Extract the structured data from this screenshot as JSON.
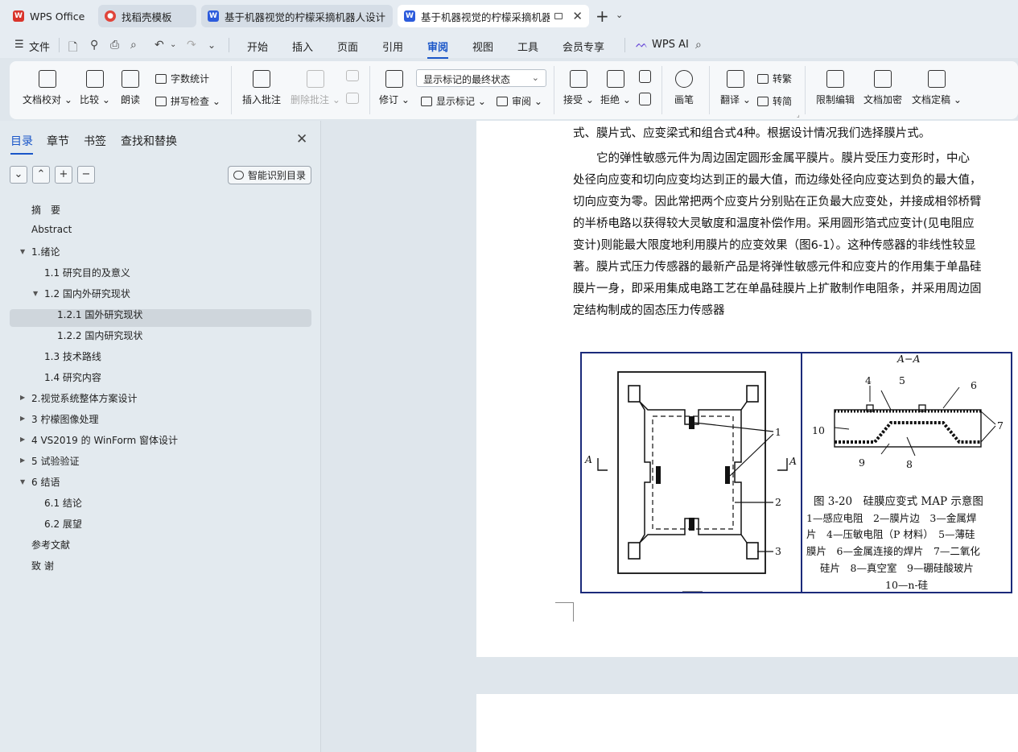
{
  "tabs": [
    {
      "label": "WPS Office",
      "icon": "wps-logo-icon",
      "color": "#d9342b"
    },
    {
      "label": "找稻壳模板",
      "icon": "daoke-icon",
      "color": "#e0443a"
    },
    {
      "label": "基于机器视觉的柠檬采摘机器人设计：",
      "icon": "writer-doc-icon",
      "color": "#2c5bdc"
    },
    {
      "label": "基于机器视觉的柠檬采摘机器人",
      "icon": "writer-doc-icon",
      "color": "#2c5bdc"
    }
  ],
  "menu": {
    "file": "文件",
    "items": [
      "开始",
      "插入",
      "页面",
      "引用",
      "审阅",
      "视图",
      "工具",
      "会员专享"
    ],
    "active": "审阅",
    "wps_ai": "WPS AI"
  },
  "ribbon": {
    "doc_check": "文档校对",
    "compare": "比较",
    "read_aloud": "朗读",
    "word_count": "字数统计",
    "spell_check": "拼写检查",
    "insert_comment": "插入批注",
    "delete_comment": "删除批注",
    "revise": "修订",
    "markup_state": "显示标记的最终状态",
    "show_markup": "显示标记",
    "review": "审阅",
    "accept": "接受",
    "reject": "拒绝",
    "pen": "画笔",
    "translate": "翻译",
    "to_traditional": "转繁",
    "to_simplified": "转简",
    "restrict_edit": "限制编辑",
    "encrypt": "文档加密",
    "finalize": "文档定稿"
  },
  "nav": {
    "tabs": [
      "目录",
      "章节",
      "书签",
      "查找和替换"
    ],
    "smart_btn": "智能识别目录",
    "toc": [
      {
        "text": "摘　要",
        "level": 0
      },
      {
        "text": "Abstract",
        "level": 0
      },
      {
        "text": "1.绪论",
        "level": 0,
        "expanded": true
      },
      {
        "text": "1.1 研究目的及意义",
        "level": 1
      },
      {
        "text": "1.2 国内外研究现状",
        "level": 1,
        "expanded": true
      },
      {
        "text": "1.2.1 国外研究现状",
        "level": 2
      },
      {
        "text": "1.2.2 国内研究现状",
        "level": 2
      },
      {
        "text": "1.3  技术路线",
        "level": 1
      },
      {
        "text": "1.4  研究内容",
        "level": 1
      },
      {
        "text": "2.视觉系统整体方案设计",
        "level": 0,
        "collapsed": true
      },
      {
        "text": "3  柠檬图像处理",
        "level": 0,
        "collapsed": true
      },
      {
        "text": "4 VS2019 的 WinForm 窗体设计",
        "level": 0,
        "collapsed": true,
        "selected": true
      },
      {
        "text": "5  试验验证",
        "level": 0,
        "collapsed": true
      },
      {
        "text": "6  结语",
        "level": 0,
        "expanded": true
      },
      {
        "text": "6.1  结论",
        "level": 1
      },
      {
        "text": "6.2  展望",
        "level": 1
      },
      {
        "text": "参考文献",
        "level": 0
      },
      {
        "text": "致 谢",
        "level": 0
      }
    ]
  },
  "doc": {
    "lines": [
      "式、膜片式、应变梁式和组合式4种。根据设计情况我们选择膜片式。",
      "　　它的弹性敏感元件为周边固定圆形金属平膜片。膜片受压力变形时，中心",
      "处径向应变和切向应变均达到正的最大值，而边缘处径向应变达到负的最大值，",
      "切向应变为零。因此常把两个应变片分别贴在正负最大应变处，并接成相邻桥臂",
      "的半桥电路以获得较大灵敏度和温度补偿作用。采用圆形箔式应变计(见电阻应",
      "变计)则能最大限度地利用膜片的应变效果（图6-1）。这种传感器的非线性较显",
      "著。膜片式压力传感器的最新产品是将弹性敏感元件和应变片的作用集于单晶硅",
      "膜片一身，即采用集成电路工艺在单晶硅膜片上扩散制作电阻条，并采用周边固",
      "定结构制成的固态压力传感器"
    ],
    "figure": {
      "section_label": "A−A",
      "left_labels": [
        "A",
        "A",
        "1",
        "2",
        "3"
      ],
      "right_labels": [
        "4",
        "5",
        "6",
        "7",
        "10",
        "9",
        "8"
      ],
      "caption_title": "图 3-20　硅膜应变式 MAP 示意图",
      "caption_lines": [
        "1—感应电阻　2—膜片边　3—金属焊",
        "片　4—压敏电阻（P 材料）　5—薄硅",
        "膜片　6—金属连接的焊片　7—二氧化",
        "硅片　8—真空室　9—硼硅酸玻片",
        "10—n-硅"
      ]
    }
  }
}
